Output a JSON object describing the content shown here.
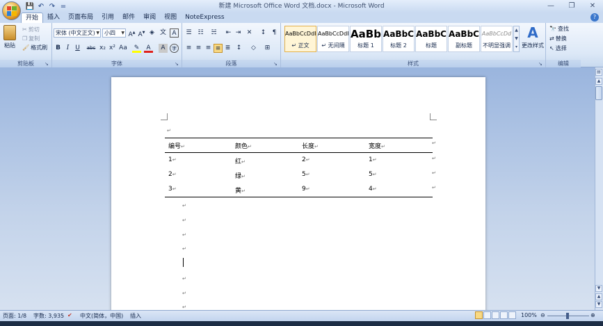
{
  "window": {
    "title": "新建 Microsoft Office Word 文档.docx - Microsoft Word",
    "controls": [
      "—",
      "❐",
      "✕"
    ]
  },
  "quick_access": [
    "💾",
    "↶",
    "↷",
    "="
  ],
  "tabs": [
    "开始",
    "插入",
    "页面布局",
    "引用",
    "邮件",
    "审阅",
    "视图",
    "NoteExpress"
  ],
  "clipboard": {
    "paste": "粘贴",
    "cut": "剪切",
    "copy": "复制",
    "format_painter": "格式刷",
    "label": "剪贴板"
  },
  "font": {
    "name": "宋体 (中文正文)",
    "size": "小四",
    "label": "字体",
    "buttons": [
      "B",
      "I",
      "U",
      "abc",
      "x₂",
      "x²",
      "Aa"
    ]
  },
  "paragraph": {
    "label": "段落"
  },
  "styles": {
    "label": "样式",
    "items": [
      {
        "preview": "AaBbCcDdI",
        "name": "↵ 正文"
      },
      {
        "preview": "AaBbCcDdI",
        "name": "↵ 无间隔"
      },
      {
        "preview": "AaBb",
        "name": "标题 1"
      },
      {
        "preview": "AaBbC",
        "name": "标题 2"
      },
      {
        "preview": "AaBbC",
        "name": "标题"
      },
      {
        "preview": "AaBbC",
        "name": "副标题"
      },
      {
        "preview": "AaBbCcDd",
        "name": "不明显强调"
      }
    ],
    "change_styles": "更改样式"
  },
  "editing": {
    "find": "查找",
    "replace": "替换",
    "select": "选择",
    "label": "编辑"
  },
  "document": {
    "table": {
      "headers": [
        "编号",
        "颜色",
        "长度",
        "宽度"
      ],
      "rows": [
        [
          "1",
          "红",
          "2",
          "1"
        ],
        [
          "2",
          "绿",
          "5",
          "5"
        ],
        [
          "3",
          "黄",
          "9",
          "4"
        ]
      ]
    },
    "paragraph_mark": "↵",
    "cell_mark": "↵"
  },
  "status": {
    "page": "页面: 1/8",
    "words": "字数: 3,935",
    "language": "中文(简体，中国)",
    "mode": "插入",
    "zoom": "100%"
  },
  "colors": {
    "ribbon_bg": "#dce8f7",
    "doc_bg": "#9ab5de",
    "selected_style": "#fff5d6"
  }
}
